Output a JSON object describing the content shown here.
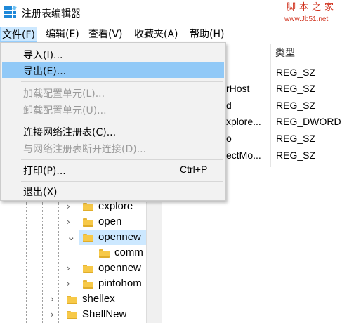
{
  "window": {
    "title": "注册表编辑器",
    "watermark_text": "脚本之家",
    "watermark_url": "www.Jb51.net"
  },
  "menubar": [
    {
      "label": "文件(F)"
    },
    {
      "label": "编辑(E)"
    },
    {
      "label": "查看(V)"
    },
    {
      "label": "收藏夹(A)"
    },
    {
      "label": "帮助(H)"
    }
  ],
  "file_menu": {
    "import": "导入(I)...",
    "export": "导出(E)...",
    "load_hive": "加载配置单元(L)...",
    "unload_hive": "卸载配置单元(U)...",
    "connect": "连接网络注册表(C)...",
    "disconnect": "与网络注册表断开连接(D)...",
    "print": "打印(P)...",
    "print_shortcut": "Ctrl+P",
    "exit": "退出(X)"
  },
  "values_panel": {
    "type_header": "类型",
    "rows": [
      {
        "name": "",
        "type": "REG_SZ"
      },
      {
        "name": "rHost",
        "type": "REG_SZ"
      },
      {
        "name": "d",
        "type": "REG_SZ"
      },
      {
        "name": "xplore...",
        "type": "REG_DWORD"
      },
      {
        "name": "o",
        "type": "REG_SZ"
      },
      {
        "name": "ectMo...",
        "type": "REG_SZ"
      }
    ]
  },
  "tree": [
    {
      "label": "explore",
      "chevron": "›"
    },
    {
      "label": "open",
      "chevron": "›"
    },
    {
      "label": "opennew",
      "chevron": "⌄"
    },
    {
      "label": "comm",
      "chevron": ""
    },
    {
      "label": "opennew",
      "chevron": "›"
    },
    {
      "label": "pintohom",
      "chevron": "›"
    },
    {
      "label": "shellex",
      "chevron": "›"
    },
    {
      "label": "ShellNew",
      "chevron": "›"
    }
  ],
  "colors": {
    "menu_hover": "#91c9f7",
    "selection": "#cce8ff",
    "watermark": "#d0331f"
  }
}
